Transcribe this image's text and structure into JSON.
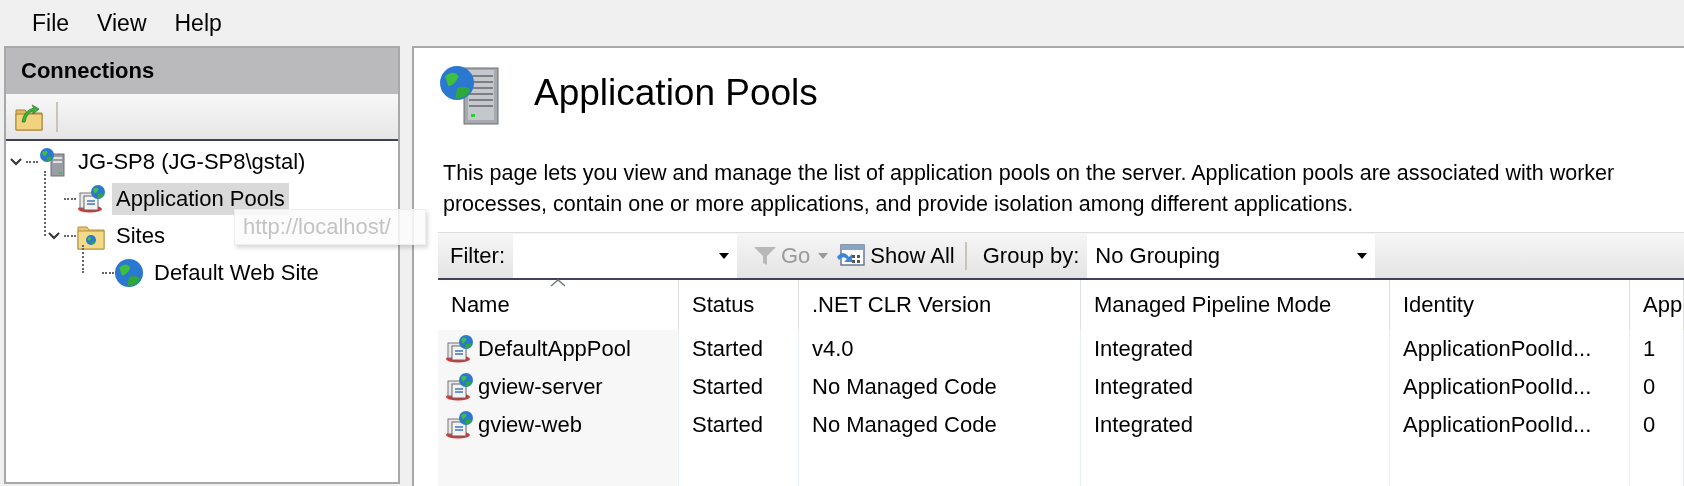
{
  "menu": [
    {
      "label": "File"
    },
    {
      "label": "View"
    },
    {
      "label": "Help"
    }
  ],
  "connections": {
    "title": "Connections",
    "tooltip": "http://localhost/",
    "tree": [
      {
        "label": "JG-SP8 (JG-SP8\\gstal)",
        "kind": "server",
        "expanded": true,
        "selected": false,
        "children": [
          {
            "label": "Application Pools",
            "kind": "pools",
            "selected": true
          },
          {
            "label": "Sites",
            "kind": "sites",
            "expanded": true,
            "selected": false,
            "children": [
              {
                "label": "Default Web Site",
                "kind": "site",
                "selected": false
              }
            ]
          }
        ]
      }
    ]
  },
  "page": {
    "title": "Application Pools",
    "description": "This page lets you view and manage the list of application pools on the server. Application pools are associated with worker processes, contain one or more applications, and provide isolation among different applications.",
    "toolbar": {
      "filter_label": "Filter:",
      "go": {
        "label": "Go",
        "disabled": true
      },
      "show_all": "Show All",
      "group_by_label": "Group by:",
      "group_by_value": "No Grouping"
    },
    "table": {
      "columns": [
        {
          "label": "Name",
          "sorted": true
        },
        {
          "label": "Status",
          "sorted": false
        },
        {
          "label": ".NET CLR Version",
          "sorted": false
        },
        {
          "label": "Managed Pipeline Mode",
          "sorted": false
        },
        {
          "label": "Identity",
          "sorted": false
        },
        {
          "label": "App",
          "sorted": false
        }
      ],
      "rows": [
        {
          "cells": [
            "DefaultAppPool",
            "Started",
            "v4.0",
            "Integrated",
            "ApplicationPoolId...",
            "1"
          ]
        },
        {
          "cells": [
            "gview-server",
            "Started",
            "No Managed Code",
            "Integrated",
            "ApplicationPoolId...",
            "0"
          ]
        },
        {
          "cells": [
            "gview-web",
            "Started",
            "No Managed Code",
            "Integrated",
            "ApplicationPoolId...",
            "0"
          ]
        }
      ]
    }
  }
}
